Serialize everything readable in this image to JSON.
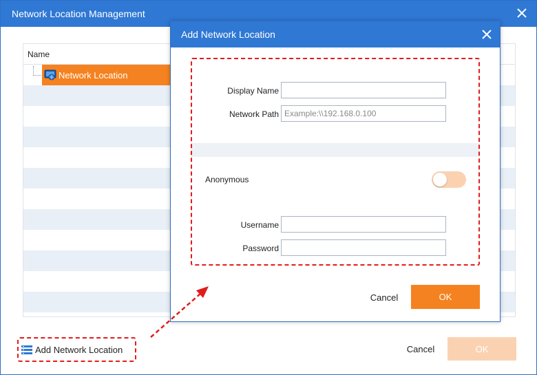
{
  "window": {
    "title": "Network Location Management",
    "list_header": "Name",
    "tree_item": "Network Location",
    "add_location": "Add Network Location",
    "cancel": "Cancel",
    "ok": "OK"
  },
  "dialog": {
    "title": "Add Network Location",
    "display_name": {
      "label": "Display Name",
      "value": "",
      "placeholder": ""
    },
    "network_path": {
      "label": "Network Path",
      "value": "",
      "placeholder": "Example:\\\\192.168.0.100"
    },
    "anonymous": {
      "label": "Anonymous",
      "on": false
    },
    "username": {
      "label": "Username",
      "value": ""
    },
    "password": {
      "label": "Password",
      "value": ""
    },
    "cancel": "Cancel",
    "ok": "OK"
  },
  "colors": {
    "title_bar": "#2f78d4",
    "accent": "#f58220",
    "accent_disabled": "#fbd2b1",
    "annotation": "#e21b1b",
    "row_stripe": "#e9eff7"
  },
  "icons": {
    "close": "close-icon",
    "network_location": "network-drive-icon",
    "add_location": "server-list-icon"
  }
}
